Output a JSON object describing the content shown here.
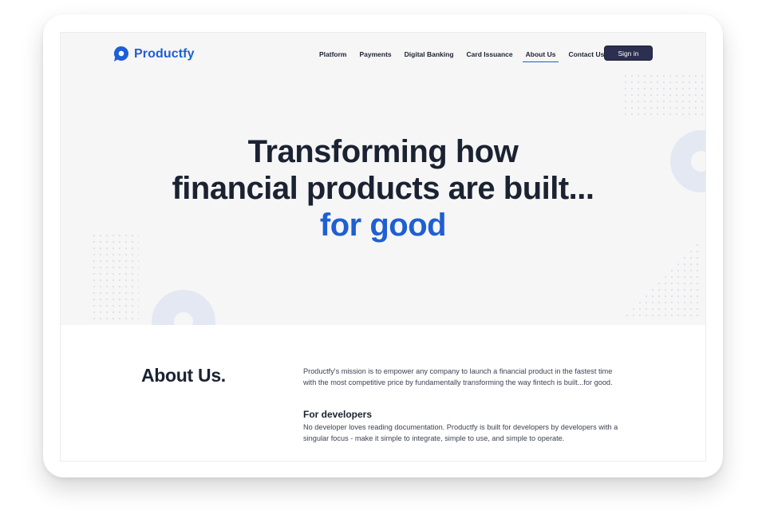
{
  "brand": {
    "name": "Productfy",
    "color": "#1d5fd6"
  },
  "nav": {
    "items": [
      {
        "label": "Platform",
        "active": false
      },
      {
        "label": "Payments",
        "active": false
      },
      {
        "label": "Digital Banking",
        "active": false
      },
      {
        "label": "Card Issuance",
        "active": false
      },
      {
        "label": "About Us",
        "active": true
      },
      {
        "label": "Contact Us",
        "active": false
      }
    ],
    "signin_label": "Sign in"
  },
  "hero": {
    "line1": "Transforming how",
    "line2": "financial products are built...",
    "accent": "for good",
    "accent_color": "#1f5fd3"
  },
  "about": {
    "title": "About Us.",
    "mission": "Productfy's mission is to empower any company to launch a financial product in the fastest time with the most competitive price by fundamentally transforming the way fintech is built...for good.",
    "developers_title": "For developers",
    "developers_text": "No developer loves reading documentation. Productfy is built for developers by developers with a singular focus - make it simple to integrate, simple to use, and simple to operate."
  },
  "icons": [
    "logo-chat-bubble-icon"
  ],
  "colors": {
    "hero_bg": "#f6f6f7",
    "signin_bg": "#2c2f4f",
    "heading": "#1b2231"
  }
}
